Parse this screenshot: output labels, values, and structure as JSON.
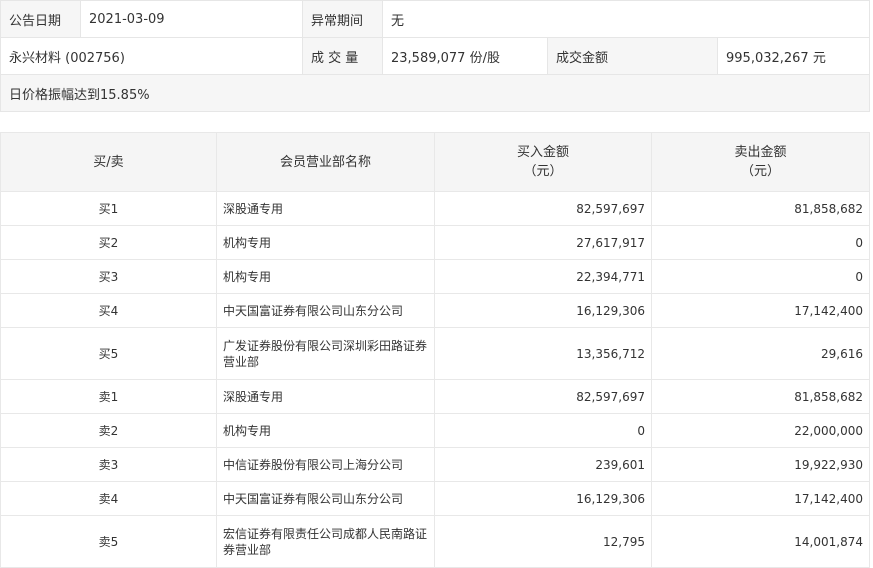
{
  "info": {
    "announce_date_label": "公告日期",
    "announce_date": "2021-03-09",
    "abnormal_period_label": "异常期间",
    "abnormal_period": "无",
    "stock": "永兴材料 (002756)",
    "volume_label": "成 交 量",
    "volume": "23,589,077 份/股",
    "amount_label": "成交金额",
    "amount": "995,032,267 元",
    "reason": "日价格振幅达到15.85%"
  },
  "table": {
    "headers": {
      "side": "买/卖",
      "broker": "会员营业部名称",
      "buy_amount_1": "买入金额",
      "buy_amount_2": "（元）",
      "sell_amount_1": "卖出金额",
      "sell_amount_2": "（元）"
    },
    "rows": [
      {
        "side": "买1",
        "broker": "深股通专用",
        "buy": "82,597,697",
        "sell": "81,858,682"
      },
      {
        "side": "买2",
        "broker": "机构专用",
        "buy": "27,617,917",
        "sell": "0"
      },
      {
        "side": "买3",
        "broker": "机构专用",
        "buy": "22,394,771",
        "sell": "0"
      },
      {
        "side": "买4",
        "broker": "中天国富证券有限公司山东分公司",
        "buy": "16,129,306",
        "sell": "17,142,400"
      },
      {
        "side": "买5",
        "broker": "广发证券股份有限公司深圳彩田路证券营业部",
        "buy": "13,356,712",
        "sell": "29,616"
      },
      {
        "side": "卖1",
        "broker": "深股通专用",
        "buy": "82,597,697",
        "sell": "81,858,682"
      },
      {
        "side": "卖2",
        "broker": "机构专用",
        "buy": "0",
        "sell": "22,000,000"
      },
      {
        "side": "卖3",
        "broker": "中信证券股份有限公司上海分公司",
        "buy": "239,601",
        "sell": "19,922,930"
      },
      {
        "side": "卖4",
        "broker": "中天国富证券有限公司山东分公司",
        "buy": "16,129,306",
        "sell": "17,142,400"
      },
      {
        "side": "卖5",
        "broker": "宏信证券有限责任公司成都人民南路证券营业部",
        "buy": "12,795",
        "sell": "14,001,874"
      }
    ]
  }
}
